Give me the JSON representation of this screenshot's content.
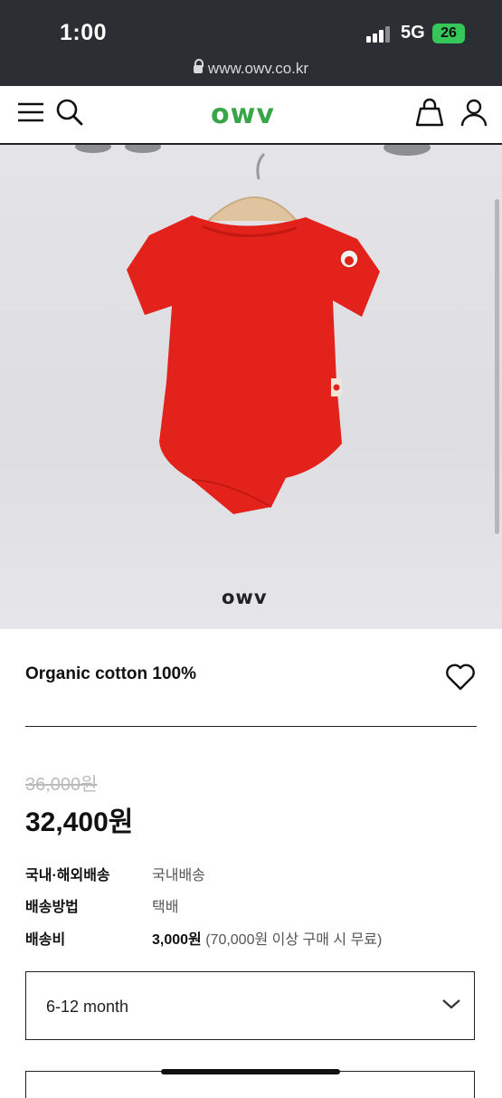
{
  "status_bar": {
    "time": "1:00",
    "network": "5G",
    "battery": "26"
  },
  "browser": {
    "url": "www.owv.co.kr"
  },
  "header": {
    "logo": "owv",
    "icons": [
      "menu-icon",
      "search-icon",
      "bag-icon",
      "user-icon"
    ],
    "logo_color": "#3aa548"
  },
  "product": {
    "image_watermark": "owv",
    "garment_color": "#e3221b",
    "title": "Organic cotton 100%",
    "original_price": "36,000원",
    "sale_price": "32,400원",
    "info": [
      {
        "label": "국내·해외배송",
        "value": "국내배송"
      },
      {
        "label": "배송방법",
        "value": "택배"
      },
      {
        "label": "배송비",
        "value_bold": "3,000원",
        "value": " (70,000원 이상 구매 시 무료)"
      }
    ],
    "option": {
      "selected": "6-12 month"
    }
  }
}
